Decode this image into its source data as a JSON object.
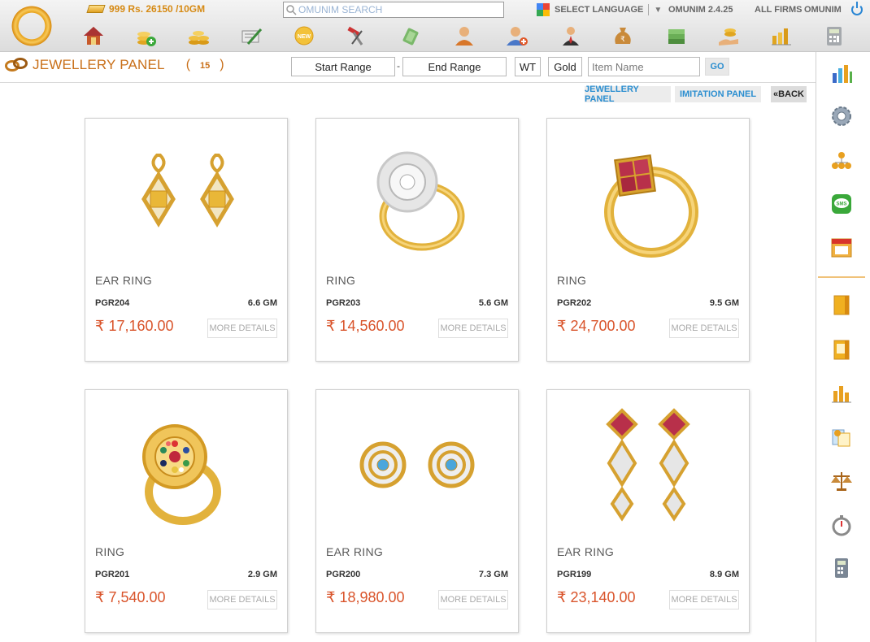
{
  "header": {
    "gold_rate": "999 Rs. 26150 /10GM",
    "search_placeholder": "OMUNIM SEARCH",
    "select_language": "SELECT LANGUAGE",
    "version": "OMUNIM 2.4.25",
    "all_firms": "ALL FIRMS",
    "user": "OMUNIM"
  },
  "toolbar": {
    "icons": [
      "home-icon",
      "add-coins-icon",
      "coins-stack-icon",
      "certificate-pen-icon",
      "new-badge-icon",
      "tools-icon",
      "money-bag-icon",
      "person-icon",
      "add-person-icon",
      "businessman-icon",
      "sack-rupee-icon",
      "cash-stack-icon",
      "hand-coins-icon",
      "bar-coins-icon",
      "calculator-icon"
    ]
  },
  "panel": {
    "title": "JEWELLERY PANEL",
    "open_paren": "(",
    "count": "15",
    "close_paren": ")"
  },
  "filters": {
    "start_range": "Start Range",
    "dash": "-",
    "end_range": "End Range",
    "wt": "WT",
    "metal": "Gold",
    "item_placeholder": "Item Name",
    "go": "GO"
  },
  "nav": {
    "jewellery_panel": "JEWELLERY PANEL",
    "imitation_panel": "IMITATION PANEL",
    "back": "«BACK"
  },
  "products": [
    {
      "name": "EAR RING",
      "code": "PGR204",
      "weight": "6.6 GM",
      "price": "₹ 17,160.00",
      "more": "MORE DETAILS",
      "image": "earring-square-citrine"
    },
    {
      "name": "RING",
      "code": "PGR203",
      "weight": "5.6 GM",
      "price": "₹ 14,560.00",
      "more": "MORE DETAILS",
      "image": "ring-diamond-cluster"
    },
    {
      "name": "RING",
      "code": "PGR202",
      "weight": "9.5 GM",
      "price": "₹ 24,700.00",
      "more": "MORE DETAILS",
      "image": "ring-ruby-square"
    },
    {
      "name": "RING",
      "code": "PGR201",
      "weight": "2.9 GM",
      "price": "₹ 7,540.00",
      "more": "MORE DETAILS",
      "image": "ring-navratna-flower"
    },
    {
      "name": "EAR RING",
      "code": "PGR200",
      "weight": "7.3 GM",
      "price": "₹ 18,980.00",
      "more": "MORE DETAILS",
      "image": "earring-blue-topaz-swirl"
    },
    {
      "name": "EAR RING",
      "code": "PGR199",
      "weight": "8.9 GM",
      "price": "₹ 23,140.00",
      "more": "MORE DETAILS",
      "image": "earring-ruby-drop"
    }
  ],
  "right_sidebar": {
    "icons": [
      "bar-chart-icon",
      "gear-icon",
      "hierarchy-icon",
      "sms-icon",
      "calendar-icon",
      "ledger-book-icon",
      "ledger-book-alt-icon",
      "column-chart-icon",
      "documents-icon",
      "scale-icon",
      "stopwatch-icon",
      "calculator-icon"
    ]
  },
  "colors": {
    "accent_orange": "#c9701a",
    "price_red": "#d9542b",
    "link_blue": "#2b8ed0",
    "gold": "#e8a21a"
  }
}
